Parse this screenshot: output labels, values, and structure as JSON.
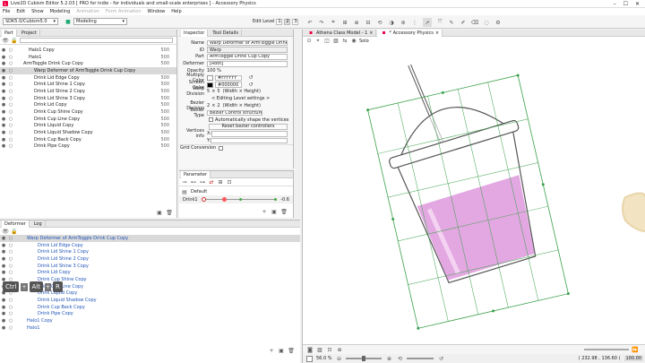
{
  "title": "Live2D Cubism Editor 5.2.03  [ PRO for indie - for individuals and small-scale enterprises ]  - Accessory Physics",
  "menu": [
    "File",
    "Edit",
    "Show",
    "Modeling",
    "Animation",
    "Form Animation",
    "Window",
    "Help"
  ],
  "toolbar": {
    "mode_left": "SDK5.0/Cubism5.0",
    "mode": "Modeling",
    "edit_level_label": "Edit Level",
    "edit_levels": [
      "1",
      "2",
      "3"
    ]
  },
  "part_panel": {
    "tabs": [
      "Part",
      "Project"
    ],
    "items": [
      {
        "label": "Halo1 Copy",
        "indent": 16,
        "num": "500"
      },
      {
        "label": "Halo1",
        "indent": 16,
        "num": "500"
      },
      {
        "label": "ArmToggle Drink Cup Copy",
        "indent": 10,
        "num": "500"
      },
      {
        "label": "Warp Deformer of ArmToggle Drink Cup Copy",
        "indent": 22,
        "num": "",
        "hl": true
      },
      {
        "label": "Drink Lid Edge Copy",
        "indent": 22,
        "num": "500"
      },
      {
        "label": "Drink Lid Shine 1 Copy",
        "indent": 22,
        "num": "500"
      },
      {
        "label": "Drink Lid Shine 2 Copy",
        "indent": 22,
        "num": "500"
      },
      {
        "label": "Drink Lid Shine 3 Copy",
        "indent": 22,
        "num": "500"
      },
      {
        "label": "Drink Lid Copy",
        "indent": 22,
        "num": "500"
      },
      {
        "label": "Drink Cup Shine Copy",
        "indent": 22,
        "num": "500"
      },
      {
        "label": "Drink Cup Line Copy",
        "indent": 22,
        "num": "500"
      },
      {
        "label": "Drink Liquid Copy",
        "indent": 22,
        "num": "500"
      },
      {
        "label": "Drink Liquid Shadow Copy",
        "indent": 22,
        "num": "500"
      },
      {
        "label": "Drink Cup Back Copy",
        "indent": 22,
        "num": "500"
      },
      {
        "label": "Drink Pipe Copy",
        "indent": 22,
        "num": "500"
      }
    ]
  },
  "deformer_panel": {
    "tabs": [
      "Deformer",
      "Log"
    ],
    "items": [
      {
        "label": "Warp Deformer of ArmToggle Drink Cup Copy",
        "indent": 14,
        "hl": true
      },
      {
        "label": "Drink Lid Edge Copy",
        "indent": 26
      },
      {
        "label": "Drink Lid Shine 1 Copy",
        "indent": 26
      },
      {
        "label": "Drink Lid Shine 2 Copy",
        "indent": 26
      },
      {
        "label": "Drink Lid Shine 3 Copy",
        "indent": 26
      },
      {
        "label": "Drink Lid Copy",
        "indent": 26
      },
      {
        "label": "Drink Cup Shine Copy",
        "indent": 26
      },
      {
        "label": "Drink Cup Line Copy",
        "indent": 26
      },
      {
        "label": "Drink Liquid Copy",
        "indent": 26
      },
      {
        "label": "Drink Liquid Shadow Copy",
        "indent": 26
      },
      {
        "label": "Drink Cup Back Copy",
        "indent": 26
      },
      {
        "label": "Drink Pipe Copy",
        "indent": 26
      },
      {
        "label": "Halo1 Copy",
        "indent": 14
      },
      {
        "label": "Halo1",
        "indent": 14
      }
    ]
  },
  "keys": [
    "Ctrl",
    "+",
    "Alt",
    "+",
    "R"
  ],
  "inspector": {
    "tabs": [
      "Inspector",
      "Tool Details"
    ],
    "name_label": "Name",
    "name_value": "Warp Deformer of ArmToggle Drink Cup Co",
    "id_label": "ID",
    "id_value": "Warp",
    "part_label": "Part",
    "part_value": "ArmToggle Drink Cup Copy",
    "deformer_label": "Deformer",
    "deformer_value": "[Root]",
    "opacity_label": "Opacity",
    "opacity_value": "100 %",
    "multiply_label": "Multiply Color",
    "multiply_value": "#FFFFFF",
    "screen_label": "Screen Color",
    "screen_value": "#000000",
    "warp_div_label": "Warp Division",
    "warp_div_value": "5",
    "warp_div_x": "5",
    "warp_div_unit": "(Width × Height)",
    "edit_level_btn": "< Editing Level settings >",
    "bezier_div_label": "Bezier Division",
    "bezier_div_value": "2",
    "bezier_div_x": "2",
    "bezier_div_unit": "(Width × Height)",
    "bezier_type_label": "Bezier Type",
    "bezier_type_value": "Bezier Control structure",
    "auto_shape_label": "Automatically shape the vertices",
    "reset_btn": "Reset bezier controllers",
    "vert_info_label": "Vertices info",
    "vx": "X:",
    "vy": "Y:",
    "grid_conv_label": "Grid Conversion"
  },
  "parameter": {
    "title": "Parameter",
    "group": "Default",
    "param_name": "Drink1",
    "param_value": "-0.6"
  },
  "canvas": {
    "tabs": [
      "Athena Class Model - 1",
      "* Accessory Physics"
    ],
    "solo": "Solo",
    "zoom": "56.0 %",
    "coords": "( 232.98 , 136.60 )",
    "zoom_bar": "100.00"
  },
  "colors": {
    "accent": "#8a8a8a",
    "grid": "#3aa04a",
    "liquid": "#d98bd8"
  }
}
